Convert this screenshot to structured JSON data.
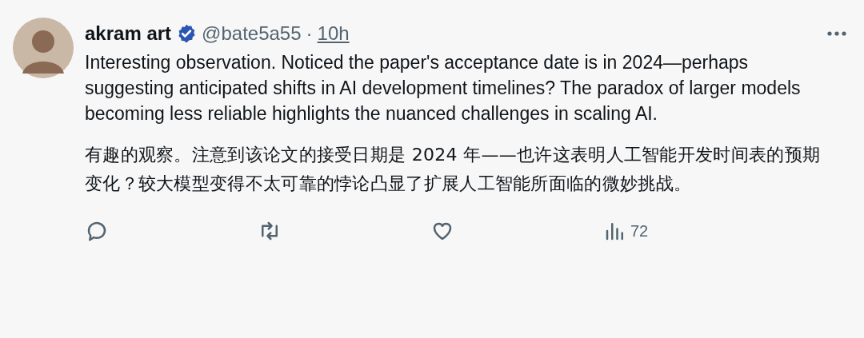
{
  "post": {
    "author": "akram art",
    "verified": true,
    "handle": "@bate5a55",
    "separator": "·",
    "time": "10h",
    "paragraphs": [
      "Interesting observation. Noticed the paper's acceptance date is in 2024—perhaps suggesting anticipated shifts in AI development timelines? The paradox of larger models becoming less reliable highlights the nuanced challenges in scaling AI.",
      "有趣的观察。注意到该论文的接受日期是 2024 年——也许这表明人工智能开发时间表的预期变化？较大模型变得不太可靠的悖论凸显了扩展人工智能所面临的微妙挑战。"
    ],
    "actions": [
      {
        "kind": "reply"
      },
      {
        "kind": "repost"
      },
      {
        "kind": "like"
      },
      {
        "kind": "views",
        "count": "72"
      }
    ]
  }
}
